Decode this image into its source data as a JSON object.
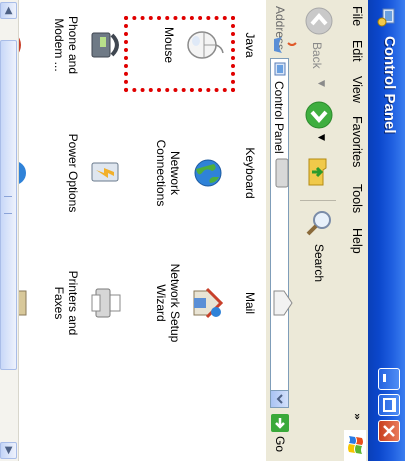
{
  "window": {
    "title": "Control Panel"
  },
  "menu": {
    "items": [
      "File",
      "Edit",
      "View",
      "Favorites",
      "Tools",
      "Help"
    ],
    "overflow": "»"
  },
  "toolbar": {
    "back_label": "Back",
    "search_label": "Search"
  },
  "address": {
    "label": "Address",
    "value": "Control Panel",
    "go_label": "Go"
  },
  "items": [
    {
      "label": "Java"
    },
    {
      "label": "Keyboard"
    },
    {
      "label": "Mail"
    },
    {
      "label": "Mouse"
    },
    {
      "label": "Network Connections"
    },
    {
      "label": "Network Setup Wizard"
    },
    {
      "label": "Phone and Modem ..."
    },
    {
      "label": "Power Options"
    },
    {
      "label": "Printers and Faxes"
    }
  ],
  "selected_item": "Mouse",
  "colors": {
    "titlebar": "#0b47cc",
    "chrome": "#ece9d8",
    "selection_marker": "#e00000"
  }
}
